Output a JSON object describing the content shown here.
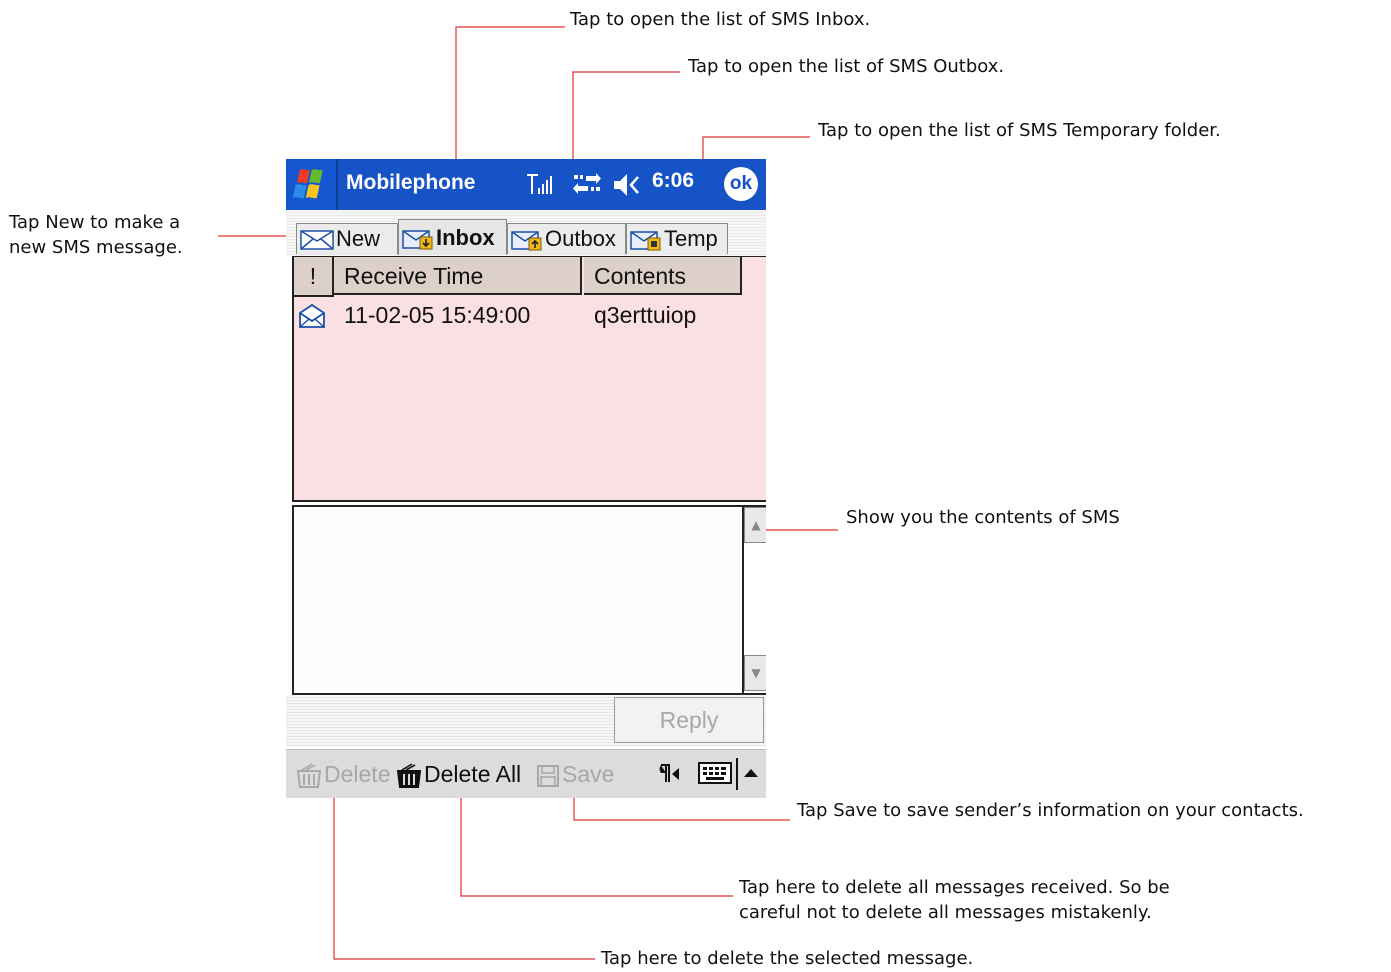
{
  "annotations": {
    "inbox": "Tap to open the list of SMS Inbox.",
    "outbox": "Tap to open the list of SMS Outbox.",
    "temp": "Tap to open the list of SMS Temporary folder.",
    "new_line1": "Tap New to make a",
    "new_line2": "new SMS message.",
    "contents": "Show you the contents of SMS",
    "save": "Tap Save to save sender’s information on your contacts.",
    "delete_all_line1": "Tap here to delete all messages received. So be",
    "delete_all_line2": "careful not to delete all messages mistakenly.",
    "delete": "Tap here to delete the selected message."
  },
  "titlebar": {
    "app_title": "Mobilephone",
    "time": "6:06",
    "ok_label": "ok"
  },
  "tabs": [
    {
      "label": "New"
    },
    {
      "label": "Inbox",
      "active": true
    },
    {
      "label": "Outbox"
    },
    {
      "label": "Temp"
    }
  ],
  "list": {
    "columns": [
      "!",
      "Receive Time",
      "Contents"
    ],
    "rows": [
      {
        "time": "11-02-05 15:49:00",
        "contents": "q3erttuiop"
      }
    ]
  },
  "reply_label": "Reply",
  "menubar": {
    "delete": "Delete",
    "delete_all": "Delete All",
    "save": "Save"
  },
  "colors": {
    "titlebar": "#1553c7",
    "list_background": "#fbe0e3",
    "callout_line": "#e03030"
  }
}
